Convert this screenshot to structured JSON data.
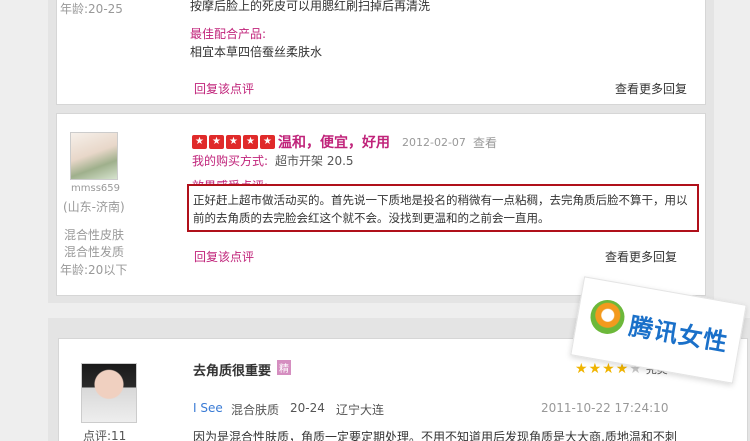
{
  "review1": {
    "age_line": "年龄:20-25",
    "text_line": "按摩后脸上的死皮可以用腮红刷扫掉后再清洗",
    "best_match_label": "最佳配合产品:",
    "best_match_value": "相宜本草四倍蚕丝柔肤水",
    "reply_link": "回复该点评",
    "more_link": "查看更多回复"
  },
  "review2": {
    "username": "mmss659",
    "location": "(山东-济南)",
    "skin_type": "混合性皮肤",
    "hair_type": "混合性发质",
    "age": "年龄:20以下",
    "rating": 5,
    "title": "温和，便宜，好用",
    "date": "2012-02-07",
    "view_link": "查看",
    "purchase_label": "我的购买方式:",
    "purchase_value": "超市开架 20.5",
    "effect_label": "效果感受点评:",
    "body_line1": "正好赶上超市做活动买的。首先说一下质地是投名的稍微有一点粘稠，去完角质后脸不算干，用以",
    "body_line2": "前的去角质的去完脸会红这个就不会。没找到更温和的之前会一直用。",
    "reply_link": "回复该点评",
    "more_link": "查看更多回复"
  },
  "review3": {
    "title": "去角质很重要",
    "title_tag": "精",
    "rating": 4.5,
    "rating_suffix": "完美",
    "username": "I See",
    "skin_type": "混合肤质",
    "age_range": "20-24",
    "location": "辽宁大连",
    "datetime": "2011-10-22 17:24:10",
    "points": "点评:11",
    "body_line1": "因为是混合性肤质，角质一定要定期处理。不用不知道用后发现角质是大大商,质地温和不刺"
  },
  "watermark": {
    "text": "腾讯女性"
  },
  "colors": {
    "accent_pink": "#c0237a",
    "highlight_border": "#b0101a",
    "star_red": "#e02a2a",
    "star_yellow": "#f0b400",
    "badge_blue": "#1a70c9"
  }
}
